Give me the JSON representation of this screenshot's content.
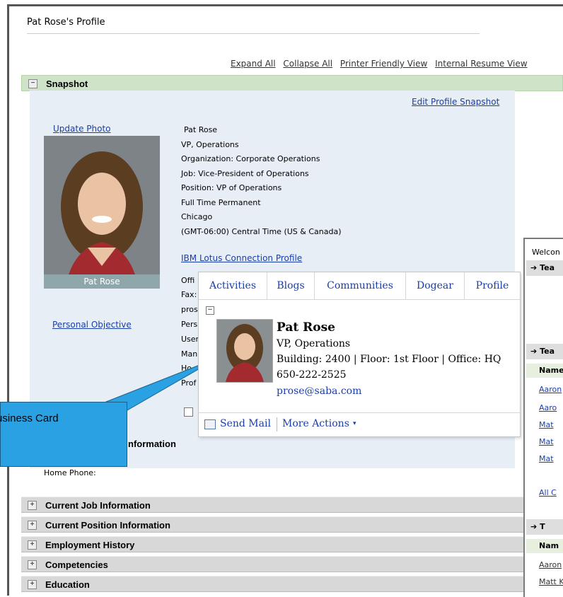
{
  "page": {
    "title": "Pat Rose's Profile"
  },
  "top_links": [
    "Expand All",
    "Collapse All",
    "Printer Friendly View",
    "Internal Resume View"
  ],
  "snapshot": {
    "header": "Snapshot",
    "edit_link": "Edit Profile Snapshot",
    "update_photo": "Update Photo",
    "photo_caption": "Pat Rose",
    "personal_objective": "Personal Objective",
    "info_lines": [
      "Pat Rose",
      "VP, Operations",
      "Organization: Corporate Operations",
      "Job: Vice-President of Operations",
      "Position: VP of Operations",
      "Full Time Permanent",
      "Chicago",
      "(GMT-06:00) Central Time (US & Canada)"
    ],
    "ibm_link": "IBM Lotus Connection Profile",
    "truncated": [
      "Offi",
      "Fax:",
      "pros",
      "Pers",
      "User",
      "Man",
      "Ho",
      "Prof"
    ],
    "contact_info_partial": "nformation",
    "home_phone_label": "Home Phone:"
  },
  "business_card": {
    "tabs": [
      "Activities",
      "Blogs",
      "Communities",
      "Dogear",
      "Profile"
    ],
    "name": "Pat Rose",
    "title": "VP, Operations",
    "location": "Building: 2400 | Floor: 1st Floor | Office: HQ",
    "phone": "650-222-2525",
    "email": "prose@saba.com",
    "send_mail": "Send Mail",
    "more_actions": "More Actions"
  },
  "callout": {
    "text": "usiness Card"
  },
  "sections": [
    "Current Job Information",
    "Current Position Information",
    "Employment History",
    "Competencies",
    "Education"
  ],
  "right_panel": {
    "welcome": "Welcon",
    "team_header_1": "Tea",
    "team_header_2": "Tea",
    "name_col": "Name",
    "names_a": [
      "Aaron",
      "Aaro",
      "Mat",
      "Mat",
      "Mat"
    ],
    "all_link": "All C",
    "team_header_3": "T",
    "name_col_2": "Nam",
    "names_b": [
      "Aaron",
      "Matt K"
    ]
  },
  "colors": {
    "link": "#1a3ea8",
    "snapshot_header": "#cfe3c8",
    "callout": "#2aa1e3"
  }
}
